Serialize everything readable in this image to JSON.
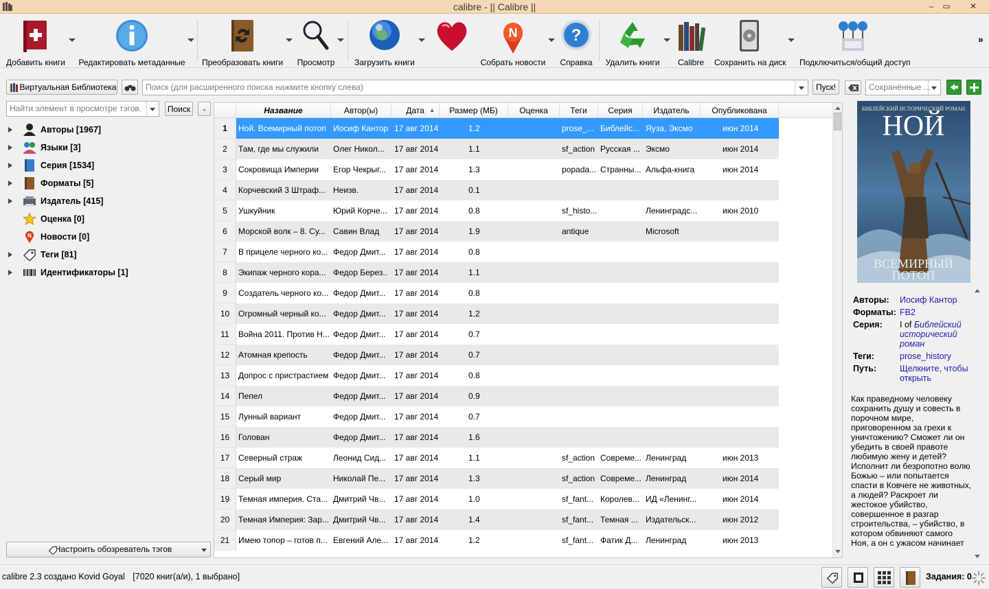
{
  "window": {
    "title": "calibre - || Calibre ||",
    "min": "–",
    "max": "▭",
    "close": "✕"
  },
  "toolbar": {
    "items": [
      {
        "label": "Добавить книги",
        "icon": "add-book-icon",
        "has_menu": true
      },
      {
        "label": "Редактировать метаданные",
        "icon": "info-icon",
        "has_menu": true
      },
      {
        "label": "Преобразовать книги",
        "icon": "convert-icon",
        "has_menu": true
      },
      {
        "label": "Просмотр",
        "icon": "magnifier-icon",
        "has_menu": true
      },
      {
        "label": "Загрузить книги",
        "icon": "globe-icon",
        "has_menu": true
      },
      {
        "label": "",
        "icon": "heart-icon",
        "has_menu": false
      },
      {
        "label": "Собрать новости",
        "icon": "news-icon",
        "has_menu": true
      },
      {
        "label": "Справка",
        "icon": "help-icon",
        "has_menu": false
      },
      {
        "label": "Удалить книги",
        "icon": "recycle-icon",
        "has_menu": true
      },
      {
        "label": "Calibre",
        "icon": "library-icon",
        "has_menu": false
      },
      {
        "label": "Сохранить на диск",
        "icon": "save-disk-icon",
        "has_menu": true
      },
      {
        "label": "Подключиться/общий доступ",
        "icon": "connect-share-icon",
        "has_menu": false
      }
    ],
    "more": "»"
  },
  "search": {
    "virtual_library": "Виртуальная Библиотека",
    "placeholder": "Поиск (для расширенного поиска нажмите кнопку слева)",
    "go": "Пуск!",
    "saved_placeholder": "Сохранённые ..."
  },
  "tag_browser": {
    "find_placeholder": "Найти элемент в просмотре тэгов.",
    "find_button": "Поиск",
    "collapse_button": "-",
    "items": [
      {
        "label": "Авторы [1967]",
        "icon": "authors-icon",
        "expandable": true
      },
      {
        "label": "Языки [3]",
        "icon": "languages-icon",
        "expandable": true
      },
      {
        "label": "Серия [1534]",
        "icon": "series-icon",
        "expandable": true
      },
      {
        "label": "Форматы [5]",
        "icon": "formats-icon",
        "expandable": true
      },
      {
        "label": "Издатель [415]",
        "icon": "publisher-icon",
        "expandable": true
      },
      {
        "label": "Оценка [0]",
        "icon": "rating-star-icon",
        "expandable": false
      },
      {
        "label": "Новости [0]",
        "icon": "news-icon",
        "expandable": false
      },
      {
        "label": "Теги [81]",
        "icon": "tag-icon",
        "expandable": true
      },
      {
        "label": "Идентификаторы [1]",
        "icon": "barcode-icon",
        "expandable": true
      }
    ],
    "configure_button": "Настроить обозреватель тэгов"
  },
  "book_list": {
    "columns": [
      "Название",
      "Автор(ы)",
      "Дата",
      "Размер (МБ)",
      "Оценка",
      "Теги",
      "Серия",
      "Издатель",
      "Опубликована"
    ],
    "sort_indicator": "▲",
    "rows": [
      {
        "n": "1",
        "title": "Ной. Всемирный потоп",
        "author": "Иосиф Кантор",
        "date": "17 авг 2014",
        "size": "1.2",
        "rating": "",
        "tags": "prose_...",
        "series": "Библейс...",
        "publisher": "Яуза, Эксмо",
        "published": "июн 2014"
      },
      {
        "n": "2",
        "title": "Там, где мы служили",
        "author": "Олег Никол...",
        "date": "17 авг 2014",
        "size": "1.1",
        "rating": "",
        "tags": "sf_action",
        "series": "Русская ...",
        "publisher": "Эксмо",
        "published": "июн 2014"
      },
      {
        "n": "3",
        "title": "Сокровища Империи",
        "author": "Егор Чекрыг...",
        "date": "17 авг 2014",
        "size": "1.3",
        "rating": "",
        "tags": "popada...",
        "series": "Странны...",
        "publisher": "Альфа-книга",
        "published": "июн 2014"
      },
      {
        "n": "4",
        "title": "Корчевский 3 Штраф...",
        "author": "Неизв.",
        "date": "17 авг 2014",
        "size": "0.1",
        "rating": "",
        "tags": "",
        "series": "",
        "publisher": "",
        "published": ""
      },
      {
        "n": "5",
        "title": "Ушкуйник",
        "author": "Юрий Корче...",
        "date": "17 авг 2014",
        "size": "0.8",
        "rating": "",
        "tags": "sf_histo...",
        "series": "",
        "publisher": "Ленинградс...",
        "published": "июн 2010"
      },
      {
        "n": "6",
        "title": "Морской волк – 8. Су...",
        "author": "Савин Влад",
        "date": "17 авг 2014",
        "size": "1.9",
        "rating": "",
        "tags": "antique",
        "series": "",
        "publisher": "Microsoft",
        "published": ""
      },
      {
        "n": "7",
        "title": "В прицеле черного ко...",
        "author": "Федор Дмит...",
        "date": "17 авг 2014",
        "size": "0.8",
        "rating": "",
        "tags": "",
        "series": "",
        "publisher": "",
        "published": ""
      },
      {
        "n": "8",
        "title": "Экипаж черного кора...",
        "author": "Федор Берез...",
        "date": "17 авг 2014",
        "size": "1.1",
        "rating": "",
        "tags": "",
        "series": "",
        "publisher": "",
        "published": ""
      },
      {
        "n": "9",
        "title": "Создатель черного ко...",
        "author": "Федор Дмит...",
        "date": "17 авг 2014",
        "size": "0.8",
        "rating": "",
        "tags": "",
        "series": "",
        "publisher": "",
        "published": ""
      },
      {
        "n": "10",
        "title": "Огромный черный ко...",
        "author": "Федор Дмит...",
        "date": "17 авг 2014",
        "size": "1.2",
        "rating": "",
        "tags": "",
        "series": "",
        "publisher": "",
        "published": ""
      },
      {
        "n": "11",
        "title": "Война 2011. Против Н...",
        "author": "Федор Дмит...",
        "date": "17 авг 2014",
        "size": "0.7",
        "rating": "",
        "tags": "",
        "series": "",
        "publisher": "",
        "published": ""
      },
      {
        "n": "12",
        "title": "Атомная крепость",
        "author": "Федор Дмит...",
        "date": "17 авг 2014",
        "size": "0.7",
        "rating": "",
        "tags": "",
        "series": "",
        "publisher": "",
        "published": ""
      },
      {
        "n": "13",
        "title": "Допрос с пристрастием",
        "author": "Федор Дмит...",
        "date": "17 авг 2014",
        "size": "0.8",
        "rating": "",
        "tags": "",
        "series": "",
        "publisher": "",
        "published": ""
      },
      {
        "n": "14",
        "title": "Пепел",
        "author": "Федор Дмит...",
        "date": "17 авг 2014",
        "size": "0.9",
        "rating": "",
        "tags": "",
        "series": "",
        "publisher": "",
        "published": ""
      },
      {
        "n": "15",
        "title": "Лунный вариант",
        "author": "Федор Дмит...",
        "date": "17 авг 2014",
        "size": "0.7",
        "rating": "",
        "tags": "",
        "series": "",
        "publisher": "",
        "published": ""
      },
      {
        "n": "16",
        "title": "Голован",
        "author": "Федор Дмит...",
        "date": "17 авг 2014",
        "size": "1.6",
        "rating": "",
        "tags": "",
        "series": "",
        "publisher": "",
        "published": ""
      },
      {
        "n": "17",
        "title": "Северный страж",
        "author": "Леонид Сид...",
        "date": "17 авг 2014",
        "size": "1.1",
        "rating": "",
        "tags": "sf_action",
        "series": "Совреме...",
        "publisher": "Ленинград",
        "published": "июн 2013"
      },
      {
        "n": "18",
        "title": "Серый мир",
        "author": "Николай Пе...",
        "date": "17 авг 2014",
        "size": "1.3",
        "rating": "",
        "tags": "sf_action",
        "series": "Совреме...",
        "publisher": "Ленинград",
        "published": "июн 2014"
      },
      {
        "n": "19",
        "title": "Темная империя. Ста...",
        "author": "Дмитрий Чв...",
        "date": "17 авг 2014",
        "size": "1.0",
        "rating": "",
        "tags": "sf_fant...",
        "series": "Королев...",
        "publisher": "ИД «Ленинг...",
        "published": "июн 2014"
      },
      {
        "n": "20",
        "title": "Темная Империя: Зар...",
        "author": "Дмитрий Чв...",
        "date": "17 авг 2014",
        "size": "1.4",
        "rating": "",
        "tags": "sf_fant...",
        "series": "Темная ...",
        "publisher": "Издательск...",
        "published": "июн 2012"
      },
      {
        "n": "21",
        "title": "Имею топор – готов п...",
        "author": "Евгений Але...",
        "date": "17 авг 2014",
        "size": "1.2",
        "rating": "",
        "tags": "sf_fant...",
        "series": "Фатик Д...",
        "publisher": "Ленинград",
        "published": "июн 2013"
      }
    ]
  },
  "book_details": {
    "cover_top_text": "БИБЛЕЙСКИЙ ИСТОРИЧЕСКИЙ РОМАН",
    "cover_title": "НОЙ",
    "cover_subtitle_1": "ВСЕМИРНЫЙ",
    "cover_subtitle_2": "ПОТОП",
    "authors_label": "Авторы:",
    "authors_value": "Иосиф Кантор",
    "formats_label": "Форматы:",
    "formats_value": "FB2",
    "series_label": "Серия:",
    "series_prefix": "I of",
    "series_value": "Библейский исторический роман",
    "tags_label": "Теги:",
    "tags_value": "prose_history",
    "path_label": "Путь:",
    "path_value": "Щелкните, чтобы открыть",
    "description": "Как праведному человеку сохранить душу и совесть в порочном мире, приговоренном за грехи к уничтожению? Сможет ли он убедить в своей правоте любимую жену и детей? Исполнит ли безропотно волю Божью – или попытается спасти в Ковчеге не животных, а людей? Раскроет ли жестокое убийство, совершенное в разгар строительства, – убийство, в котором обвиняют самого Ноя, а он с ужасом начинает"
  },
  "status": {
    "version": "calibre 2.3 создано Kovid Goyal",
    "count": "[7020 книг(а/и), 1 выбрано]",
    "jobs": "Задания: 0"
  },
  "colors": {
    "selection": "#3399ff",
    "titlebar": "#f5d9b4",
    "link": "#2020b0"
  }
}
